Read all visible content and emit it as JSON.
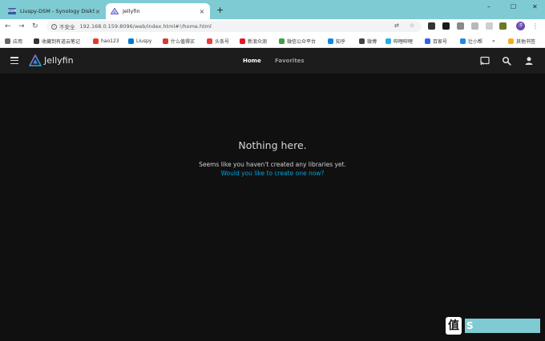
{
  "browser": {
    "tabs": [
      {
        "title": "Liuspy-DSM - Synology DiskS",
        "active": false
      },
      {
        "title": "Jellyfin",
        "active": true
      }
    ],
    "new_tab_icon": "plus-icon",
    "address": {
      "security_label": "不安全",
      "url": "192.168.0.159:8096/web/index.html#!/home.html"
    },
    "profile_initial": "淳",
    "bookmarks": [
      {
        "label": "应用",
        "color": "#555555"
      },
      {
        "label": "收藏到有道云笔记",
        "color": "#333333"
      },
      {
        "label": "hao123",
        "color": "#e33b2e"
      },
      {
        "label": "Liuspy",
        "color": "#0078d4"
      },
      {
        "label": "什么值得买",
        "color": "#d43c33"
      },
      {
        "label": "头条号",
        "color": "#ea3d3d"
      },
      {
        "label": "新浪众测",
        "color": "#e6162d"
      },
      {
        "label": "微信公众平台",
        "color": "#3aa043"
      },
      {
        "label": "知乎",
        "color": "#0f88eb"
      },
      {
        "label": "微博",
        "color": "#333333"
      },
      {
        "label": "哔哩哔哩",
        "color": "#23ade5"
      },
      {
        "label": "百家号",
        "color": "#2e62f1"
      },
      {
        "label": "壮小帮",
        "color": "#1e88e5"
      },
      {
        "label": "»",
        "color": ""
      },
      {
        "label": "其他书签",
        "color": "#f2b01e"
      }
    ]
  },
  "jellyfin": {
    "brand": "Jellyfin",
    "nav": {
      "home": "Home",
      "favorites": "Favorites"
    },
    "empty": {
      "title": "Nothing here.",
      "text": "Seems like you haven't created any libraries yet.",
      "link": "Would you like to create one now?"
    },
    "colors": {
      "accent": "#00a4dc",
      "background": "#101010",
      "header": "#1c1c1c"
    }
  },
  "watermark": {
    "badge": "值",
    "text": "S"
  }
}
